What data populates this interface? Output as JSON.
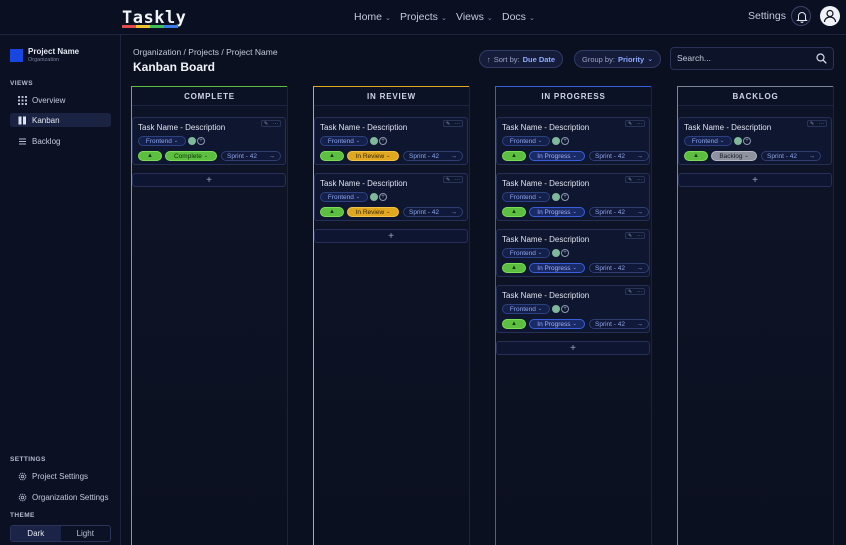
{
  "brand": {
    "name": "Taskly",
    "bar_colors": [
      "#e04b4b",
      "#f0c330",
      "#3fbf5a",
      "#3a7de8"
    ]
  },
  "nav": {
    "items": [
      {
        "label": "Home"
      },
      {
        "label": "Projects"
      },
      {
        "label": "Views"
      },
      {
        "label": "Docs"
      }
    ],
    "settings": "Settings"
  },
  "sidebar": {
    "project_name": "Project Name",
    "project_org": "Organization",
    "views_label": "VIEWS",
    "views": [
      {
        "label": "Overview",
        "icon": "grid-icon"
      },
      {
        "label": "Kanban",
        "icon": "kanban-icon"
      },
      {
        "label": "Backlog",
        "icon": "list-icon"
      }
    ],
    "settings_label": "SETTINGS",
    "settings": [
      {
        "label": "Project Settings",
        "icon": "gear-icon"
      },
      {
        "label": "Organization Settings",
        "icon": "gear-icon"
      }
    ],
    "theme_label": "THEME",
    "theme_dark": "Dark",
    "theme_light": "Light"
  },
  "header": {
    "breadcrumb": "Organization / Projects / Project Name",
    "title": "Kanban Board",
    "sort_prefix": "Sort by:",
    "sort_value": "Due Date",
    "group_prefix": "Group by:",
    "group_value": "Priority",
    "search_placeholder": "Search..."
  },
  "colors": {
    "complete": "#5cbf3f",
    "in_review": "#e0a81e",
    "in_progress": "#3a5fd8",
    "backlog": "#7e8798",
    "accent": "#8ea8ff"
  },
  "columns": [
    {
      "title": "COMPLETE",
      "cards": [
        {
          "title": "Task Name - Description",
          "tag": "Frontend",
          "status": "Complete",
          "sprint": "Sprint - 42"
        }
      ],
      "add": "+"
    },
    {
      "title": "IN REVIEW",
      "cards": [
        {
          "title": "Task Name - Description",
          "tag": "Frontend",
          "status": "In Review",
          "sprint": "Sprint - 42"
        },
        {
          "title": "Task Name - Description",
          "tag": "Frontend",
          "status": "In Review",
          "sprint": "Sprint - 42"
        }
      ],
      "add": "+"
    },
    {
      "title": "IN PROGRESS",
      "cards": [
        {
          "title": "Task Name - Description",
          "tag": "Frontend",
          "status": "In Progress",
          "sprint": "Sprint - 42"
        },
        {
          "title": "Task Name - Description",
          "tag": "Frontend",
          "status": "In Progress",
          "sprint": "Sprint - 42"
        },
        {
          "title": "Task Name - Description",
          "tag": "Frontend",
          "status": "In Progress",
          "sprint": "Sprint - 42"
        },
        {
          "title": "Task Name - Description",
          "tag": "Frontend",
          "status": "In Progress",
          "sprint": "Sprint - 42"
        }
      ],
      "add": "+"
    },
    {
      "title": "BACKLOG",
      "cards": [
        {
          "title": "Task Name - Description",
          "tag": "Frontend",
          "status": "Backlog",
          "sprint": "Sprint - 42"
        }
      ],
      "add": "+"
    }
  ]
}
